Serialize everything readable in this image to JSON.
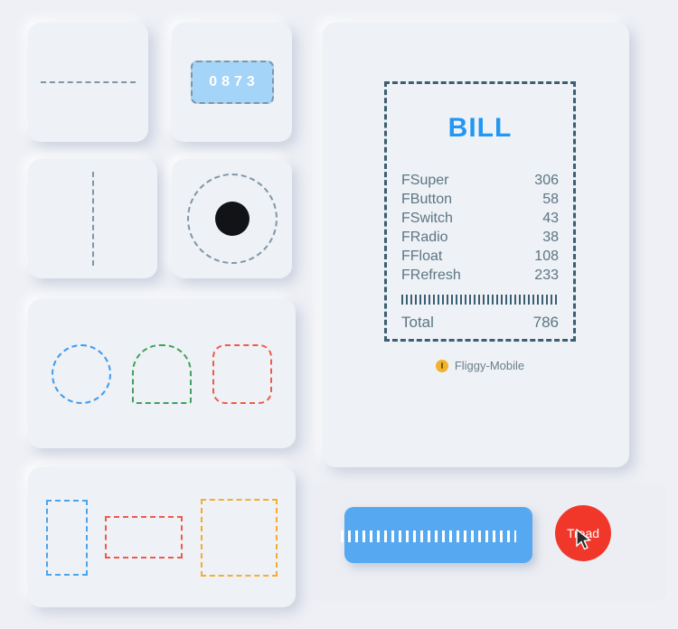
{
  "canvas": {
    "background": "#eef0f5"
  },
  "cards": {
    "dash_horizontal": {
      "name": "dashed-horizontal-line",
      "color": "#7f97a5"
    },
    "dash_vertical": {
      "name": "dashed-vertical-line",
      "color": "#7f97a5"
    },
    "number_badge": {
      "value": "0873",
      "fill": "#a4d4f7",
      "text_color": "#ffffff",
      "border_color": "#7f97a5"
    },
    "radio_dot": {
      "ring_color": "#7f97a5",
      "dot_color": "#111316"
    }
  },
  "shapes_row": [
    {
      "shape": "circle",
      "color": "#3f9bf0"
    },
    {
      "shape": "arch",
      "color": "#41a05c"
    },
    {
      "shape": "rounded-square",
      "color": "#ef5a4c"
    }
  ],
  "rects_row": [
    {
      "shape": "tall-rectangle",
      "color": "#4aa5ef"
    },
    {
      "shape": "wide-rectangle",
      "color": "#ef5a4c"
    },
    {
      "shape": "square",
      "color": "#f5ad31"
    }
  ],
  "bill": {
    "title": "BILL",
    "title_color": "#2196f3",
    "border_color": "#3b5f73",
    "items": [
      {
        "label": "FSuper",
        "amount": "306"
      },
      {
        "label": "FButton",
        "amount": "58"
      },
      {
        "label": "FSwitch",
        "amount": "43"
      },
      {
        "label": "FRadio",
        "amount": "38"
      },
      {
        "label": "FFloat",
        "amount": "108"
      },
      {
        "label": "FRefresh",
        "amount": "233"
      }
    ],
    "total": {
      "label": "Total",
      "amount": "786"
    },
    "footer": {
      "icon": "fliggy-badge-icon",
      "label": "Fliggy-Mobile",
      "icon_color": "#f2b32a"
    }
  },
  "tread_row": {
    "slider": {
      "name": "blue-slider-bar",
      "fill": "#56a9f0",
      "tick_color": "#ffffff"
    },
    "button": {
      "label": "Tread",
      "fill": "#f0372a",
      "text_color": "#ffffff"
    },
    "cursor": {
      "name": "mouse-pointer"
    }
  }
}
